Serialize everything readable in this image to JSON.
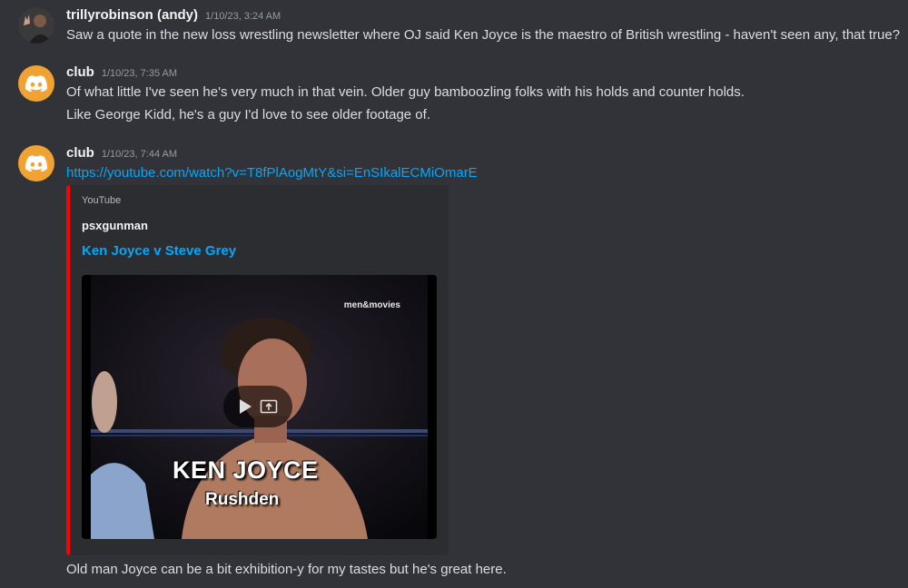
{
  "messages": [
    {
      "username": "trillyrobinson (andy)",
      "timestamp": "1/10/23, 3:24 AM",
      "lines": [
        "Saw a quote in the new loss wrestling newsletter where OJ said Ken Joyce is the maestro of British wrestling - haven't seen any, that true?"
      ]
    },
    {
      "username": "club",
      "timestamp": "1/10/23, 7:35 AM",
      "lines": [
        "Of what little I've seen he's very much in that vein. Older guy bamboozling folks with his holds and counter holds.",
        "Like George Kidd, he's a guy I'd love to see older footage of."
      ]
    },
    {
      "username": "club",
      "timestamp": "1/10/23, 7:44 AM",
      "link": "https://youtube.com/watch?v=T8fPlAogMtY&si=EnSIkalECMiOmarE",
      "embed": {
        "provider": "YouTube",
        "author": "psxgunman",
        "title": "Ken Joyce v Steve Grey",
        "accent_color": "#ff0000",
        "video": {
          "watermark": "men&movies",
          "caption_name": "KEN JOYCE",
          "caption_town": "Rushden"
        }
      },
      "followup": "Old man Joyce can be a bit exhibition-y for my tastes but he's great here."
    }
  ],
  "colors": {
    "background": "#313338",
    "link": "#00a8fc",
    "discord_avatar": "#f0a232"
  }
}
